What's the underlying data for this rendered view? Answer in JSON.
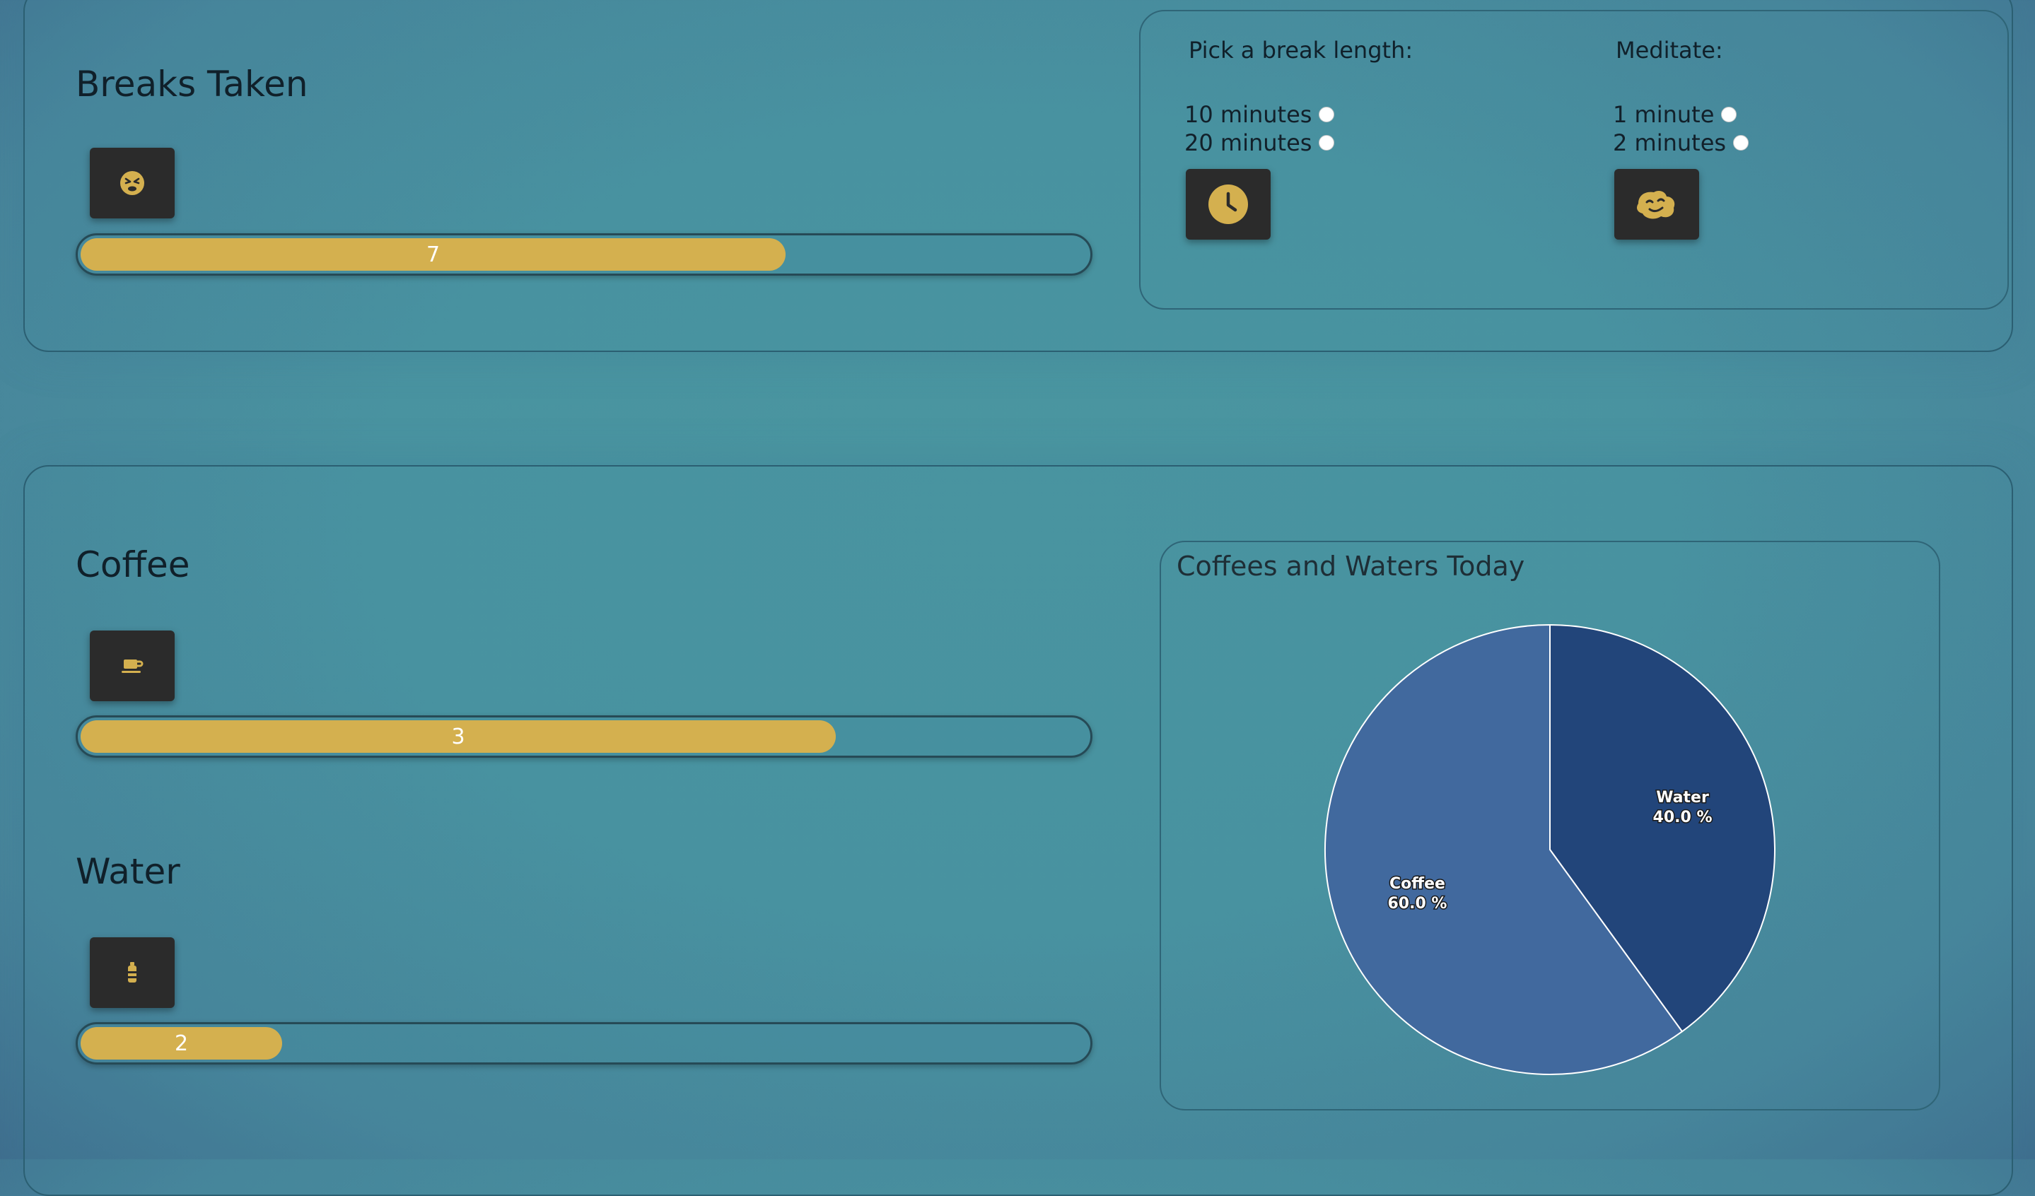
{
  "breaks": {
    "title": "Breaks Taken",
    "icon": "tired-face-icon",
    "progress": {
      "value": "7",
      "fraction": 0.7
    }
  },
  "break_options": {
    "length_heading": "Pick a break length:",
    "length_options": [
      "10 minutes",
      "20 minutes"
    ],
    "length_button_icon": "clock-icon",
    "meditate_heading": "Meditate:",
    "meditate_options": [
      "1 minute",
      "2 minutes"
    ],
    "meditate_button_icon": "meditation-icon"
  },
  "coffee": {
    "title": "Coffee",
    "icon": "coffee-cup-icon",
    "progress": {
      "value": "3",
      "fraction": 0.75
    }
  },
  "water": {
    "title": "Water",
    "icon": "water-bottle-icon",
    "progress": {
      "value": "2",
      "fraction": 0.2
    }
  },
  "colors": {
    "accent": "#d4b04f",
    "button_bg": "#2b2b2b",
    "pie_water": "#22457a",
    "pie_coffee": "#41699e"
  },
  "chart_data": {
    "type": "pie",
    "title": "Coffees and Waters Today",
    "slices": [
      {
        "label": "Water",
        "value": 40.0,
        "pct_label": "40.0 %"
      },
      {
        "label": "Coffee",
        "value": 60.0,
        "pct_label": "60.0 %"
      }
    ]
  }
}
